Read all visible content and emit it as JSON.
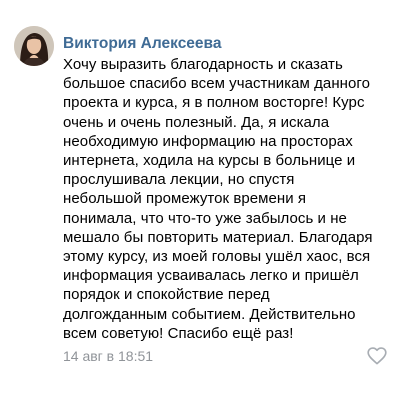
{
  "comment": {
    "author": "Виктория Алексеева",
    "text_lines": [
      "Хочу выразить благодарность и сказать",
      "большое спасибо всем участникам данного",
      "проекта и курса, я в полном восторге! Курс",
      "очень и очень полезный. Да, я искала",
      "необходимую информацию на просторах",
      "интернета, ходила на курсы в больнице и",
      "прослушивала лекции, но спустя",
      "небольшой промежуток времени я",
      "понимала, что что-то уже забылось и не",
      "мешало бы повторить материал. Благодаря",
      "этому курсу, из моей головы ушёл хаос, вся",
      "информация усваивалась легко и пришёл",
      "порядок и спокойствие перед",
      "долгожданным событием. Действительно",
      "всем советую! Спасибо ещё раз!"
    ],
    "timestamp": "14 авг в 18:51"
  },
  "icons": {
    "avatar": "user-photo",
    "like": "heart-outline-icon"
  },
  "colors": {
    "author": "#3f6b95",
    "text": "#000000",
    "timestamp": "#909499",
    "like_icon": "#a8adb3"
  }
}
